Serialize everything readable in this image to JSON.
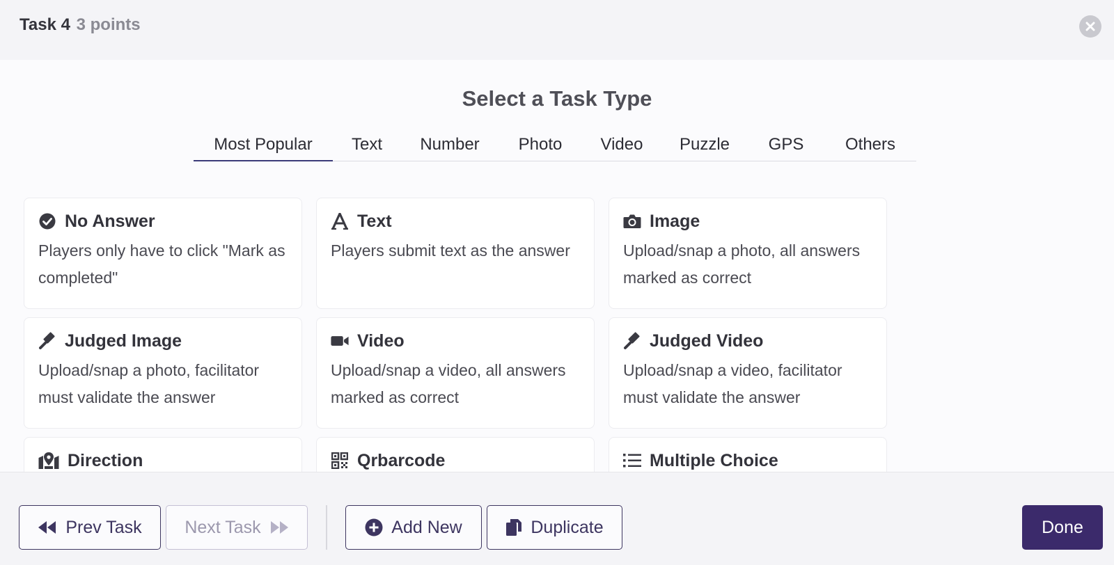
{
  "header": {
    "task_label": "Task 4",
    "points_label": "3 points"
  },
  "main": {
    "title": "Select a Task Type",
    "tabs": [
      {
        "label": "Most Popular",
        "active": true
      },
      {
        "label": "Text"
      },
      {
        "label": "Number"
      },
      {
        "label": "Photo"
      },
      {
        "label": "Video"
      },
      {
        "label": "Puzzle"
      },
      {
        "label": "GPS"
      },
      {
        "label": "Others"
      }
    ],
    "cards": [
      {
        "icon": "check-circle-icon",
        "title": "No Answer",
        "desc": "Players only have to click \"Mark as completed\""
      },
      {
        "icon": "letter-a-icon",
        "title": "Text",
        "desc": "Players submit text as the answer"
      },
      {
        "icon": "camera-icon",
        "title": "Image",
        "desc": "Upload/snap a photo, all answers marked as correct"
      },
      {
        "icon": "gavel-icon",
        "title": "Judged Image",
        "desc": "Upload/snap a photo, facilitator must validate the answer"
      },
      {
        "icon": "video-camera-icon",
        "title": "Video",
        "desc": "Upload/snap a video, all answers marked as correct"
      },
      {
        "icon": "gavel-icon",
        "title": "Judged Video",
        "desc": "Upload/snap a video, facilitator must validate the answer"
      },
      {
        "icon": "map-marker-icon",
        "title": "Direction",
        "desc": ""
      },
      {
        "icon": "qrcode-icon",
        "title": "Qrbarcode",
        "desc": ""
      },
      {
        "icon": "list-icon",
        "title": "Multiple Choice",
        "desc": ""
      }
    ]
  },
  "footer": {
    "prev_label": "Prev Task",
    "next_label": "Next Task",
    "add_label": "Add New",
    "duplicate_label": "Duplicate",
    "done_label": "Done"
  },
  "colors": {
    "accent": "#3b2a6b",
    "muted": "#9c98ad",
    "icon": "#3a3a42"
  }
}
